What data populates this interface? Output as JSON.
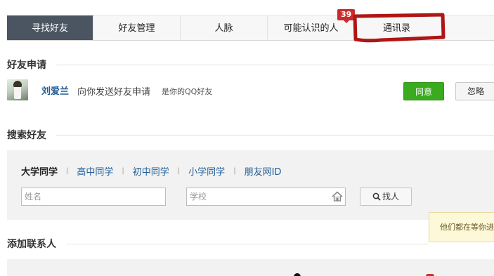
{
  "tabs": {
    "items": [
      {
        "label": "寻找好友",
        "active": true
      },
      {
        "label": "好友管理",
        "active": false
      },
      {
        "label": "人脉",
        "active": false
      },
      {
        "label": "可能认识的人",
        "active": false
      },
      {
        "label": "通讯录",
        "active": false
      }
    ],
    "badge_count": "39",
    "highlight_color": "#b01515"
  },
  "friend_requests": {
    "title": "好友申请",
    "items": [
      {
        "name": "刘爱兰",
        "message": "向你发送好友申请",
        "note": "是你的QQ好友",
        "accept_label": "同意",
        "ignore_label": "忽略"
      }
    ]
  },
  "search_friends": {
    "title": "搜索好友",
    "school_tabs": [
      {
        "label": "大学同学",
        "active": true
      },
      {
        "label": "高中同学",
        "active": false
      },
      {
        "label": "初中同学",
        "active": false
      },
      {
        "label": "小学同学",
        "active": false
      },
      {
        "label": "朋友网ID",
        "active": false
      }
    ],
    "separator": "|",
    "name_placeholder": "姓名",
    "school_placeholder": "学校",
    "find_label": "找人"
  },
  "tooltip": {
    "text": "他们都在等你进"
  },
  "add_contacts": {
    "title": "添加联系人"
  },
  "colors": {
    "active_tab": "#4b5562",
    "link": "#1f5c96",
    "accept_button": "#3aaa1f",
    "badge": "#cc2b2b"
  }
}
